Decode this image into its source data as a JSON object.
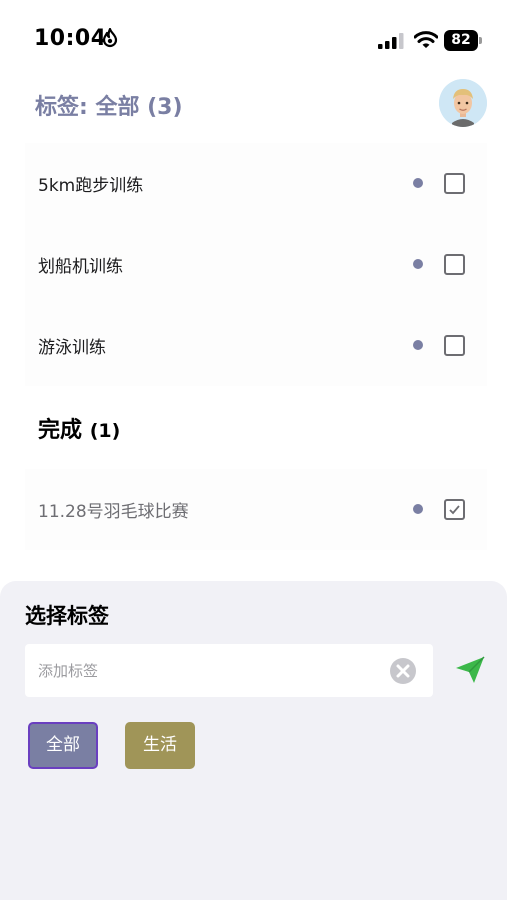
{
  "status_bar": {
    "time": "10:04",
    "battery": "82"
  },
  "header": {
    "title": "标签: 全部 (3)"
  },
  "tasks": [
    {
      "label": "5km跑步训练",
      "done": false
    },
    {
      "label": "划船机训练",
      "done": false
    },
    {
      "label": "游泳训练",
      "done": false
    }
  ],
  "completed_section": {
    "title": "完成",
    "count": "(1)",
    "tasks": [
      {
        "label": "11.28号羽毛球比赛",
        "done": true
      }
    ]
  },
  "tag_sheet": {
    "title": "选择标签",
    "input_placeholder": "添加标签",
    "input_value": "",
    "tags": [
      {
        "label": "全部",
        "color": "#7a7fa3",
        "selected": true
      },
      {
        "label": "生活",
        "color": "#a09558",
        "selected": false
      }
    ]
  },
  "colors": {
    "accent": "#7a7fa3",
    "send": "#3cb84a",
    "selected_border": "#6a3fc0"
  },
  "icons": [
    "flame-icon",
    "signal-icon",
    "wifi-icon",
    "battery-icon",
    "avatar",
    "checkbox-icon",
    "clear-icon",
    "send-icon"
  ]
}
